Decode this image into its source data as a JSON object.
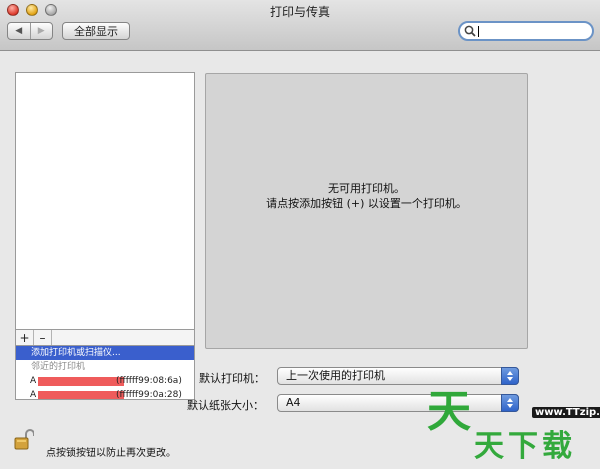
{
  "window": {
    "title": "打印与传真"
  },
  "toolbar": {
    "back": "◀",
    "forward": "▶",
    "show_all_label": "全部显示",
    "search": {
      "value": "",
      "placeholder": ""
    }
  },
  "printer_list": {
    "add_button": "+",
    "remove_button": "–",
    "menu": {
      "add_item": "添加打印机或扫描仪...",
      "nearby_header": "邻近的打印机",
      "printers": [
        {
          "prefix": "A",
          "address": "(ffffff99:08:6a)"
        },
        {
          "prefix": "A",
          "address": "(ffffff99:0a:28)"
        }
      ]
    }
  },
  "detail": {
    "line1": "无可用打印机。",
    "line2": "请点按添加按钮 (+) 以设置一个打印机。"
  },
  "settings": {
    "default_printer_label": "默认打印机：",
    "default_printer_value": "上一次使用的打印机",
    "default_paper_label": "默认纸张大小：",
    "default_paper_value": "A4"
  },
  "footer": {
    "lock_text": "点按锁按钮以防止再次更改。"
  },
  "watermark": {
    "url": "www.TTzip.com",
    "big": "天",
    "small": "天下载"
  },
  "colors": {
    "selection": "#3a5fcd",
    "redaction": "#ef5b5b",
    "watermark_green": "#30a83a"
  }
}
